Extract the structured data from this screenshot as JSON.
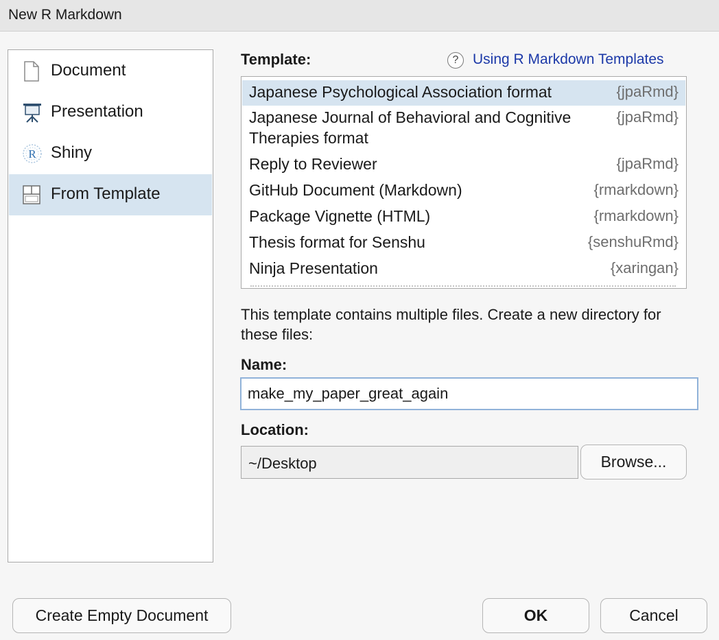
{
  "window": {
    "title": "New R Markdown"
  },
  "sidebar": {
    "items": [
      {
        "label": "Document",
        "icon": "document-icon",
        "selected": false
      },
      {
        "label": "Presentation",
        "icon": "presentation-icon",
        "selected": false
      },
      {
        "label": "Shiny",
        "icon": "shiny-icon",
        "selected": false
      },
      {
        "label": "From Template",
        "icon": "template-icon",
        "selected": true
      }
    ]
  },
  "main": {
    "template_label": "Template:",
    "help_link": {
      "icon": "help-icon",
      "icon_glyph": "?",
      "label": "Using R Markdown Templates"
    },
    "templates": [
      {
        "name": "Japanese Psychological Association format",
        "package": "{jpaRmd}",
        "selected": true
      },
      {
        "name": "Japanese Journal of Behavioral and Cognitive",
        "name_line2": "Therapies format",
        "package": "{jpaRmd}"
      },
      {
        "name": "Reply to Reviewer",
        "package": "{jpaRmd}"
      },
      {
        "name": "GitHub Document (Markdown)",
        "package": "{rmarkdown}"
      },
      {
        "name": "Package Vignette (HTML)",
        "package": "{rmarkdown}"
      },
      {
        "name": "Thesis format for Senshu",
        "package": "{senshuRmd}"
      },
      {
        "name": "Ninja Presentation",
        "package": "{xaringan}"
      }
    ],
    "info_text": "This template contains multiple files. Create a new directory for these files:",
    "name_label": "Name:",
    "name_value": "make_my_paper_great_again",
    "location_label": "Location:",
    "location_value": "~/Desktop",
    "browse_label": "Browse..."
  },
  "footer": {
    "create_empty_label": "Create Empty Document",
    "ok_label": "OK",
    "cancel_label": "Cancel"
  },
  "colors": {
    "selection": "#d6e4f0",
    "link": "#1c39a8",
    "focus_border": "#90b2d9"
  }
}
